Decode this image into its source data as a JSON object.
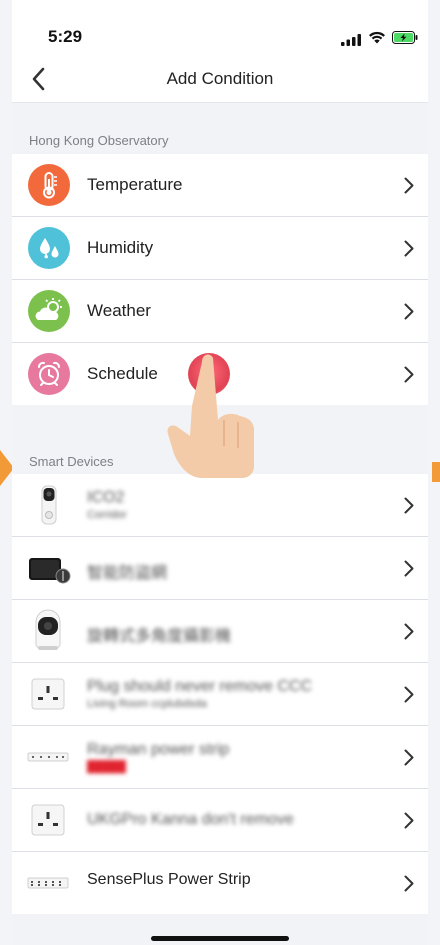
{
  "status_bar": {
    "time": "5:29"
  },
  "nav": {
    "title": "Add Condition"
  },
  "sections": {
    "observatory": {
      "header": "Hong Kong Observatory"
    },
    "smart_devices": {
      "header": "Smart Devices"
    }
  },
  "conditions": [
    {
      "label": "Temperature",
      "icon": "thermometer-icon",
      "color": "#f26a3c"
    },
    {
      "label": "Humidity",
      "icon": "water-drops-icon",
      "color": "#4fc1d8"
    },
    {
      "label": "Weather",
      "icon": "sun-cloud-icon",
      "color": "#7cc14d"
    },
    {
      "label": "Schedule",
      "icon": "alarm-clock-icon",
      "color": "#e7799e"
    }
  ],
  "devices": [
    {
      "name": "ICO2",
      "subtitle": "Corridor",
      "icon": "doorbell-camera-icon"
    },
    {
      "name": "智能防盜網",
      "subtitle": "",
      "icon": "hub-panel-icon"
    },
    {
      "name": "旋轉式多角度攝影機",
      "subtitle": "",
      "icon": "pan-camera-icon"
    },
    {
      "name": "Plug should never remove CCC",
      "subtitle": "Living Room ccplubdsda",
      "icon": "wall-socket-icon"
    },
    {
      "name": "Rayman power strip",
      "subtitle": "█████",
      "icon": "power-strip-icon"
    },
    {
      "name": "UKGPro Kanna don't remove",
      "subtitle": "",
      "icon": "wall-socket-icon"
    },
    {
      "name": "SensePlus Power Strip",
      "subtitle": "",
      "icon": "power-strip-icon"
    }
  ]
}
